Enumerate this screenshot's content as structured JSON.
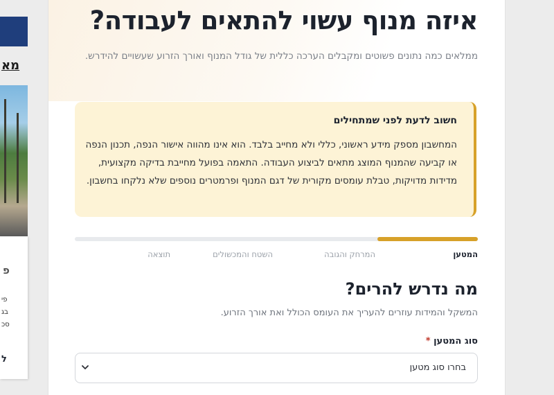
{
  "side": {
    "link_text": "מא",
    "card_title": "פ",
    "card_lines": [
      "פי",
      "בג",
      "סכ"
    ],
    "card_bottom": "ל"
  },
  "page": {
    "title": "איזה מנוף עשוי להתאים לעבודה?",
    "subtitle": "ממלאים כמה נתונים פשוטים ומקבלים הערכה כללית של גודל המנוף ואורך הזרוע שעשויים להידרש."
  },
  "notice": {
    "title": "חשוב לדעת לפני שמתחילים",
    "body": "המחשבון מספק מידע ראשוני, כללי ולא מחייב בלבד. הוא אינו מהווה אישור הנפה, תכנון הנפה או קביעה שהמנוף המוצג מתאים לביצוע העבודה. התאמה בפועל מחייבת בדיקה מקצועית, מדידות מדויקות, טבלת עומסים מקורית של דגם המנוף ופרמטרים נוספים שלא נלקחו בחשבון."
  },
  "progress": {
    "percent": 25,
    "color": "#d7a129"
  },
  "steps": [
    {
      "label": "המטען",
      "active": true
    },
    {
      "label": "המרחק והגובה",
      "active": false
    },
    {
      "label": "השטח והמכשולים",
      "active": false
    },
    {
      "label": "תוצאה",
      "active": false
    }
  ],
  "section": {
    "title": "מה נדרש להרים?",
    "subtitle": "המשקל והמידות עוזרים להעריך את העומס הכולל ואת אורך הזרוע."
  },
  "field": {
    "label": "סוג המטען",
    "required_mark": "*",
    "selected_value": "בחרו סוג מטען",
    "icon": "chevron-down-icon"
  },
  "colors": {
    "accent": "#d7a129",
    "brand_blue": "#1f3e7c",
    "notice_bg": "#fdf3d6"
  }
}
